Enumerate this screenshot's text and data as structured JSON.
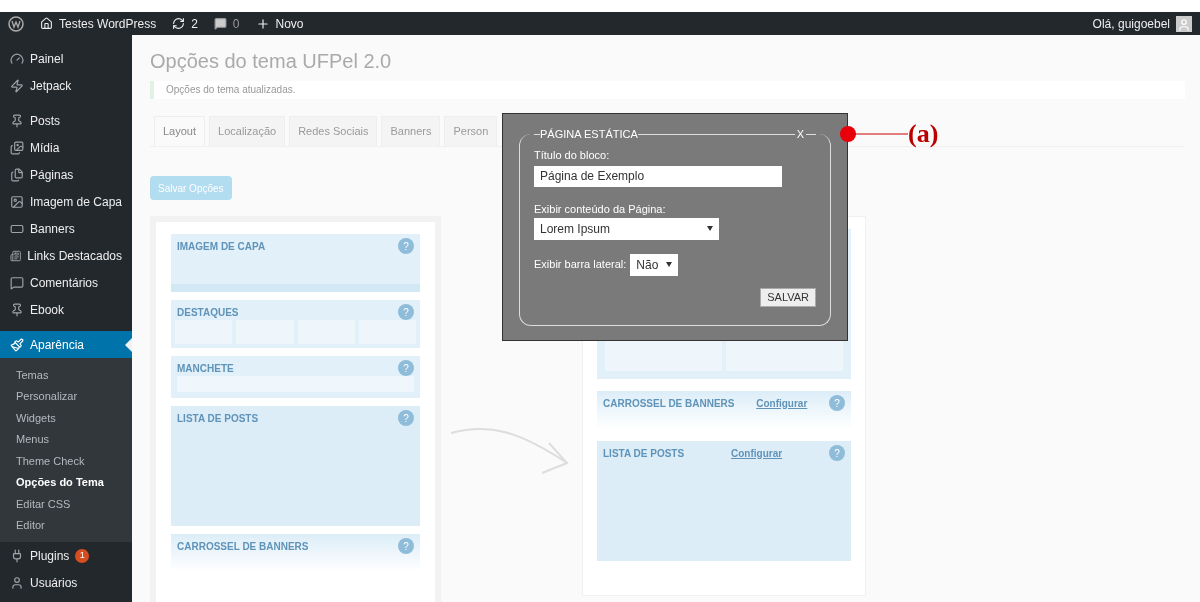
{
  "admin_bar": {
    "site": "Testes WordPress",
    "updates": "2",
    "comments": "0",
    "new": "Novo",
    "greeting": "Olá, guigoebel"
  },
  "sidebar": {
    "sections": [
      {
        "items": [
          {
            "label": "Painel",
            "selected": false
          },
          {
            "label": "Jetpack",
            "selected": false
          }
        ]
      },
      {
        "items": [
          {
            "label": "Posts",
            "selected": false
          },
          {
            "label": "Mídia",
            "selected": false
          },
          {
            "label": "Páginas",
            "selected": false
          },
          {
            "label": "Imagem de Capa",
            "selected": false
          },
          {
            "label": "Banners",
            "selected": false
          },
          {
            "label": "Links Destacados",
            "selected": false
          },
          {
            "label": "Comentários",
            "selected": false
          },
          {
            "label": "Ebook",
            "selected": false
          }
        ]
      },
      {
        "items": [
          {
            "label": "Aparência",
            "selected": true,
            "children": [
              {
                "label": "Temas",
                "selected": false
              },
              {
                "label": "Personalizar",
                "selected": false
              },
              {
                "label": "Widgets",
                "selected": false
              },
              {
                "label": "Menus",
                "selected": false
              },
              {
                "label": "Theme Check",
                "selected": false
              },
              {
                "label": "Opções do Tema",
                "selected": true
              },
              {
                "label": "Editar CSS",
                "selected": false
              },
              {
                "label": "Editor",
                "selected": false
              }
            ]
          },
          {
            "label": "Plugins",
            "selected": false,
            "badge": "1"
          },
          {
            "label": "Usuários",
            "selected": false
          }
        ]
      }
    ]
  },
  "page": {
    "title": "Opções do tema UFPel 2.0",
    "notice": "Opções do tema atualizadas.",
    "tabs": [
      {
        "label": "Layout",
        "selected": true
      },
      {
        "label": "Localização",
        "selected": false
      },
      {
        "label": "Redes Sociais",
        "selected": false
      },
      {
        "label": "Banners",
        "selected": false
      },
      {
        "label": "Person",
        "selected": false
      }
    ],
    "save_button": "Salvar Opções",
    "left_layout": [
      {
        "kind": "cover",
        "title": "IMAGEM DE CAPA",
        "help": "?"
      },
      {
        "kind": "highlights",
        "title": "DESTAQUES",
        "help": "?"
      },
      {
        "kind": "headline",
        "title": "MANCHETE",
        "help": "?"
      },
      {
        "kind": "posts",
        "title": "LISTA DE POSTS",
        "help": "?"
      },
      {
        "kind": "carousel",
        "title": "CARROSSEL DE BANNERS",
        "help": "?"
      }
    ],
    "right_layout": [
      {
        "kind": "slider"
      },
      {
        "kind": "carousel",
        "title": "CARROSSEL DE BANNERS",
        "link": "Configurar",
        "help": "?"
      },
      {
        "kind": "posts",
        "title": "LISTA DE POSTS",
        "link": "Configurar",
        "help": "?"
      }
    ]
  },
  "dialog": {
    "legend": "PÁGINA ESTÁTICA",
    "close": "X",
    "title_label": "Título do bloco:",
    "title_value": "Página de Exemplo",
    "content_label": "Exibir conteúdo da Página:",
    "content_value": "Lorem Ipsum",
    "sidebar_label": "Exibir barra lateral:",
    "sidebar_value": "Não",
    "save": "SALVAR"
  },
  "annotation": {
    "label": "(a)"
  }
}
